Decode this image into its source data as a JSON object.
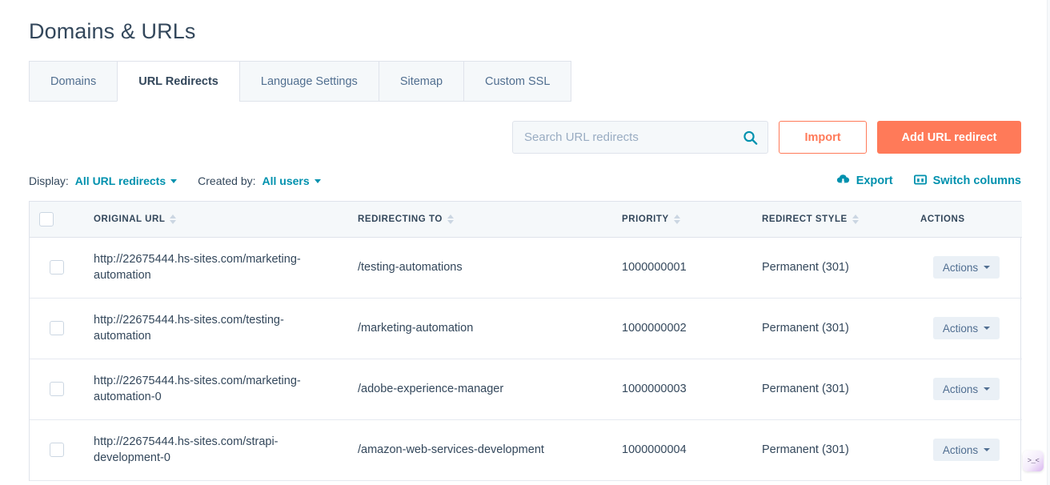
{
  "header": {
    "title": "Domains & URLs"
  },
  "tabs": [
    {
      "label": "Domains",
      "active": false
    },
    {
      "label": "URL Redirects",
      "active": true
    },
    {
      "label": "Language Settings",
      "active": false
    },
    {
      "label": "Sitemap",
      "active": false
    },
    {
      "label": "Custom SSL",
      "active": false
    }
  ],
  "toolbar": {
    "search_placeholder": "Search URL redirects",
    "search_value": "",
    "search_icon": "search-icon",
    "import_label": "Import",
    "add_label": "Add URL redirect"
  },
  "filters": {
    "display_label": "Display:",
    "display_value": "All URL redirects",
    "created_by_label": "Created by:",
    "created_by_value": "All users",
    "export_label": "Export",
    "export_icon": "cloud-download-icon",
    "switch_columns_label": "Switch columns",
    "switch_columns_icon": "columns-icon"
  },
  "table": {
    "columns": [
      {
        "key": "check",
        "label": ""
      },
      {
        "key": "original",
        "label": "ORIGINAL URL",
        "sortable": true
      },
      {
        "key": "redirect",
        "label": "REDIRECTING TO",
        "sortable": true
      },
      {
        "key": "priority",
        "label": "PRIORITY",
        "sortable": true
      },
      {
        "key": "style",
        "label": "REDIRECT STYLE",
        "sortable": true
      },
      {
        "key": "actions",
        "label": "ACTIONS",
        "sortable": false
      }
    ],
    "row_action_label": "Actions",
    "rows": [
      {
        "original": "http://22675444.hs-sites.com/marketing-automation",
        "redirect": "/testing-automations",
        "priority": "1000000001",
        "style": "Permanent (301)",
        "action": "Actions"
      },
      {
        "original": "http://22675444.hs-sites.com/testing-automation",
        "redirect": "/marketing-automation",
        "priority": "1000000002",
        "style": "Permanent (301)",
        "action": "Actions"
      },
      {
        "original": "http://22675444.hs-sites.com/marketing-automation-0",
        "redirect": "/adobe-experience-manager",
        "priority": "1000000003",
        "style": "Permanent (301)",
        "action": "Actions"
      },
      {
        "original": "http://22675444.hs-sites.com/strapi-development-0",
        "redirect": "/amazon-web-services-development",
        "priority": "1000000004",
        "style": "Permanent (301)",
        "action": "Actions"
      }
    ]
  },
  "widget": {
    "glyph": ">_<"
  },
  "colors": {
    "accent_orange": "#ff7a59",
    "link_teal": "#0091ae",
    "text_dark": "#33475b",
    "header_bg": "#f5f8fa",
    "border": "#dfe3eb"
  }
}
